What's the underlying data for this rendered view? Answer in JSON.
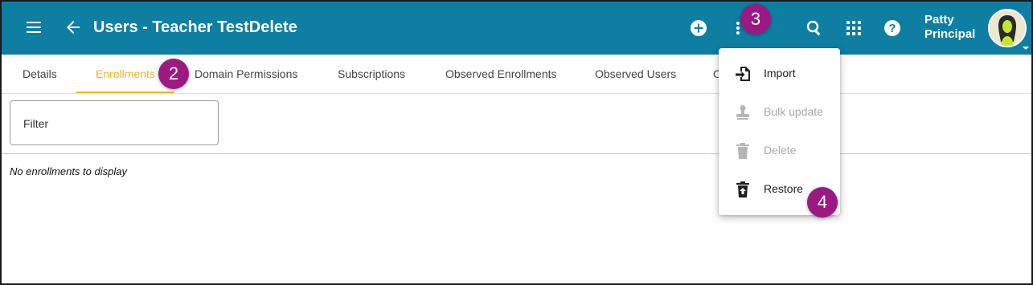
{
  "header": {
    "title": "Users - Teacher TestDelete",
    "user_first": "Patty",
    "user_last": "Principal",
    "background": "#0e7ea3"
  },
  "icons": {
    "menu": "hamburger-menu-icon",
    "back": "arrow-left-icon",
    "add": "plus-circle-icon",
    "more": "more-vert-icon",
    "search": "search-icon",
    "apps": "apps-grid-icon",
    "help": "help-circle-icon"
  },
  "tabs": [
    {
      "label": "Details"
    },
    {
      "label": "Enrollments",
      "active": true
    },
    {
      "label": "Domain Permissions"
    },
    {
      "label": "Subscriptions"
    },
    {
      "label": "Observed Enrollments"
    },
    {
      "label": "Observed Users"
    },
    {
      "label": "O"
    }
  ],
  "tab_active_color": "#f3b420",
  "filter": {
    "label": "Filter"
  },
  "empty_message": "No enrollments to display",
  "menu": {
    "items": [
      {
        "label": "Import",
        "icon": "import-icon",
        "enabled": true
      },
      {
        "label": "Bulk update",
        "icon": "stamp-icon",
        "enabled": false
      },
      {
        "label": "Delete",
        "icon": "trash-icon",
        "enabled": false
      },
      {
        "label": "Restore",
        "icon": "restore-from-trash-icon",
        "enabled": true
      }
    ]
  },
  "badges": {
    "step2": "2",
    "step3": "3",
    "step4": "4",
    "color": "#9b1a82"
  }
}
